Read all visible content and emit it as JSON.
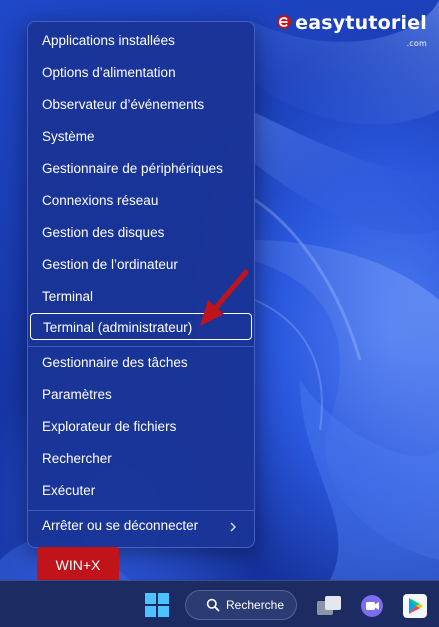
{
  "watermark": {
    "brand": "easytutoriel",
    "suffix": ".com",
    "logo_icon": "e-letter-logo-icon"
  },
  "menu": {
    "items": [
      {
        "label": "Applications installées"
      },
      {
        "label": "Options d’alimentation"
      },
      {
        "label": "Observateur d’événements"
      },
      {
        "label": "Système"
      },
      {
        "label": "Gestionnaire de périphériques"
      },
      {
        "label": "Connexions réseau"
      },
      {
        "label": "Gestion des disques"
      },
      {
        "label": "Gestion de l’ordinateur"
      },
      {
        "label": "Terminal"
      },
      {
        "label": "Terminal (administrateur)",
        "highlighted": true
      },
      {
        "label": "Gestionnaire des tâches"
      },
      {
        "label": "Paramètres"
      },
      {
        "label": "Explorateur de fichiers"
      },
      {
        "label": "Rechercher"
      },
      {
        "label": "Exécuter"
      },
      {
        "label": "Arrêter ou se déconnecter",
        "submenu": true
      }
    ],
    "submenu_icon": "chevron-right-icon"
  },
  "annotation": {
    "shortcut_badge": "WIN+X",
    "arrow_color": "#c0131a"
  },
  "taskbar": {
    "start_icon": "windows-logo-icon",
    "search_icon": "search-icon",
    "search_label": "Recherche",
    "taskview_icon": "task-view-icon",
    "teams_icon": "teams-chat-icon",
    "store_icon": "google-play-icon"
  },
  "colors": {
    "accent_red": "#c0131a",
    "menu_bg": "#1a3496",
    "taskbar_bg": "#1c2c63"
  }
}
